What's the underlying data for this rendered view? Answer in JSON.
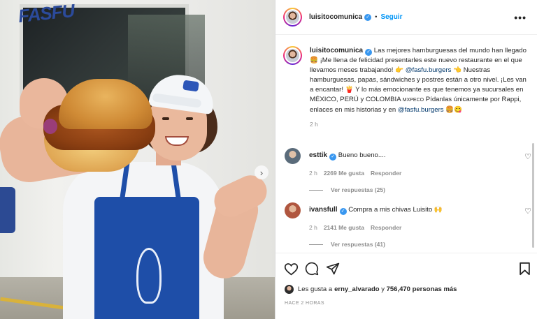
{
  "post": {
    "author": "luisitocomunica",
    "follow_label": "Seguir",
    "more_label": "•••",
    "dot": "•",
    "caption": {
      "username": "luisitocomunica",
      "part1": " Las mejores hamburguesas del mundo han llegado 🍔 ¡Me llena de felicidad presentarles este nuevo restaurante en el que llevamos meses trabajando! 👉 ",
      "mention1": "@fasfu.burgers",
      "part2": " 👈 Nuestras hamburguesas, papas, sándwiches y postres están a otro nivel. ¡Les van a encantar! 🍟 Y lo más emocionante es que tenemos ya sucursales en MÉXICO, PERÚ y COLOMBIA ",
      "small_caps": "MXPECO",
      "part3": " Pídanlas únicamente por Rappi, enlaces en mis historias y en ",
      "mention2": "@fasfu.burgers",
      "part4": " 🍔😋"
    },
    "caption_time": "2 h",
    "comments": [
      {
        "username": "esttik",
        "text": " Bueno bueno....",
        "time": "2 h",
        "likes": "2269 Me gusta",
        "reply": "Responder",
        "view_replies": "Ver respuestas (25)",
        "avatar_color": "#5a6b7a"
      },
      {
        "username": "ivansfull",
        "text": " Compra a mis chivas Luisito 🙌",
        "time": "2 h",
        "likes": "2141 Me gusta",
        "reply": "Responder",
        "view_replies": "Ver respuestas (41)",
        "avatar_color": "#b0563f"
      }
    ],
    "likes_line": {
      "prefix": "Les gusta a ",
      "user": "erny_alvarado",
      "middle": " y ",
      "count": "756,470 personas más"
    },
    "ago": "HACE 2 HORAS"
  },
  "photo": {
    "truck_logo": "FASFU",
    "next_arrow": "›"
  },
  "icons": {
    "verified": "✓",
    "heart_small": "♡"
  },
  "colors": {
    "link": "#0095f6",
    "mention": "#00376b",
    "verified": "#3897f0",
    "apron": "#1e4ea8"
  }
}
